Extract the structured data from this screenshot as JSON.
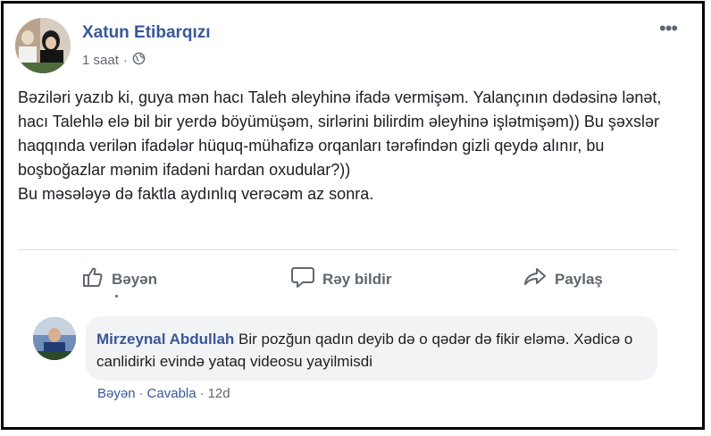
{
  "post": {
    "author": "Xatun Etibarqızı",
    "time": "1 saat",
    "meta_separator": "·",
    "audience_icon": "globe-icon",
    "more_icon": "more-options-icon",
    "more_label": "•••",
    "text_lines": [
      "Bəziləri yazıb ki, guya mən hacı Taleh əleyhinə ifadə vermişəm. Yalançının dədəsinə lənət, hacı Talehlə elə bil bir yerdə böyümüşəm, sirlərini bilirdim əleyhinə işlətmişəm)) Bu şəxslər haqqında verilən ifadələr hüquq-mühafizə orqanları tərəfindən gizli qeydə alınır, bu boşboğazlar mənim ifadəni hardan oxudular?))",
      "Bu məsələyə də faktla aydınlıq verəcəm az sonra."
    ]
  },
  "actions": {
    "like": {
      "label": "Bəyən",
      "icon": "like-icon"
    },
    "comment": {
      "label": "Rəy bildir",
      "icon": "comment-icon"
    },
    "share": {
      "label": "Paylaş",
      "icon": "share-icon"
    }
  },
  "comment": {
    "author": "Mirzeynal Abdullah",
    "text": "Bir pozğun qadın deyib də o qədər də fikir eləmə. Xədicə o canlidirki evində yataq videosu yayilmisdi",
    "like_label": "Bəyən",
    "separator": "·",
    "reply_label": "Cavabla",
    "time": "12d"
  },
  "colors": {
    "link": "#385898",
    "meta": "#606770",
    "text": "#1c1e21",
    "bubble": "#f2f3f5"
  }
}
